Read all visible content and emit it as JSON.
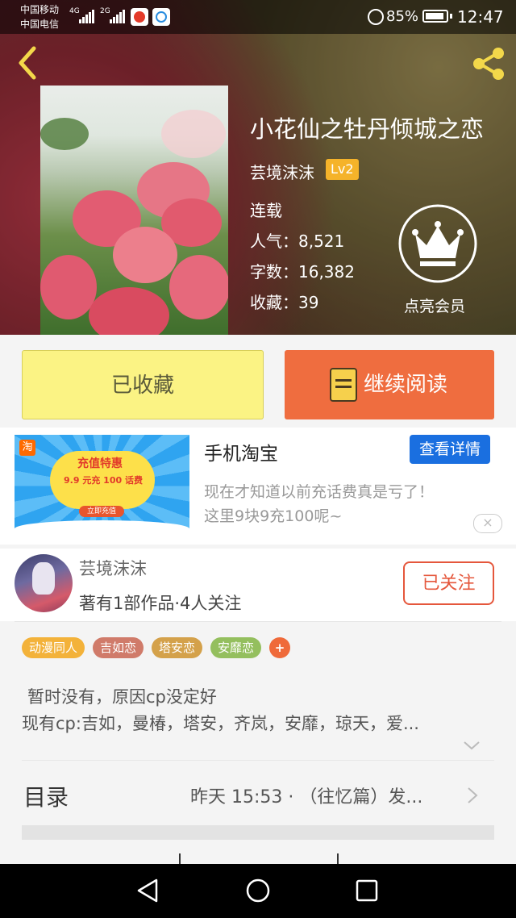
{
  "status_bar": {
    "carrier1": "中国移动",
    "carrier2": "中国电信",
    "net1": "4G",
    "net2": "2G",
    "battery": "85%",
    "time": "12:47"
  },
  "book": {
    "title": "小花仙之牡丹倾城之恋",
    "author": "芸境沫沫",
    "level": "Lv2",
    "status": "连载",
    "popularity": "人气：8,521",
    "word_count": "字数：16,382",
    "favorites": "收藏：39"
  },
  "vip": {
    "label": "点亮会员"
  },
  "actions": {
    "favorited": "已收藏",
    "continue_reading": "继续阅读"
  },
  "ad": {
    "title": "手机淘宝",
    "detail_button": "查看详情",
    "line1": "现在才知道以前充话费真是亏了！",
    "line2": "这里9块9充100呢~",
    "banner_logo": "淘",
    "banner_heading": "充值特惠",
    "banner_text": "9.9 元充 100 话费",
    "banner_button": "立即充值"
  },
  "author_card": {
    "name": "芸境沫沫",
    "stats": "著有1部作品·4人关注",
    "follow_button": "已关注"
  },
  "tags": [
    {
      "label": "动漫同人",
      "color": "#f3b23a"
    },
    {
      "label": "吉如恋",
      "color": "#d07b6a"
    },
    {
      "label": "塔安恋",
      "color": "#d4a14a"
    },
    {
      "label": "安靡恋",
      "color": "#94bf5e"
    }
  ],
  "tag_add": "+",
  "description": {
    "line1": "暂时没有，原因cp没定好",
    "line2": "现有cp:吉如，曼椿，塔安，齐岚，安靡，琼天，爱..."
  },
  "catalog": {
    "label": "目录",
    "latest": "昨天 15:53 · （往忆篇）发..."
  },
  "colors": {
    "accent_orange": "#ef6d3f",
    "favorited_yellow": "#fbf384",
    "ad_blue": "#1a6fe0",
    "follow_red": "#e5573c"
  }
}
